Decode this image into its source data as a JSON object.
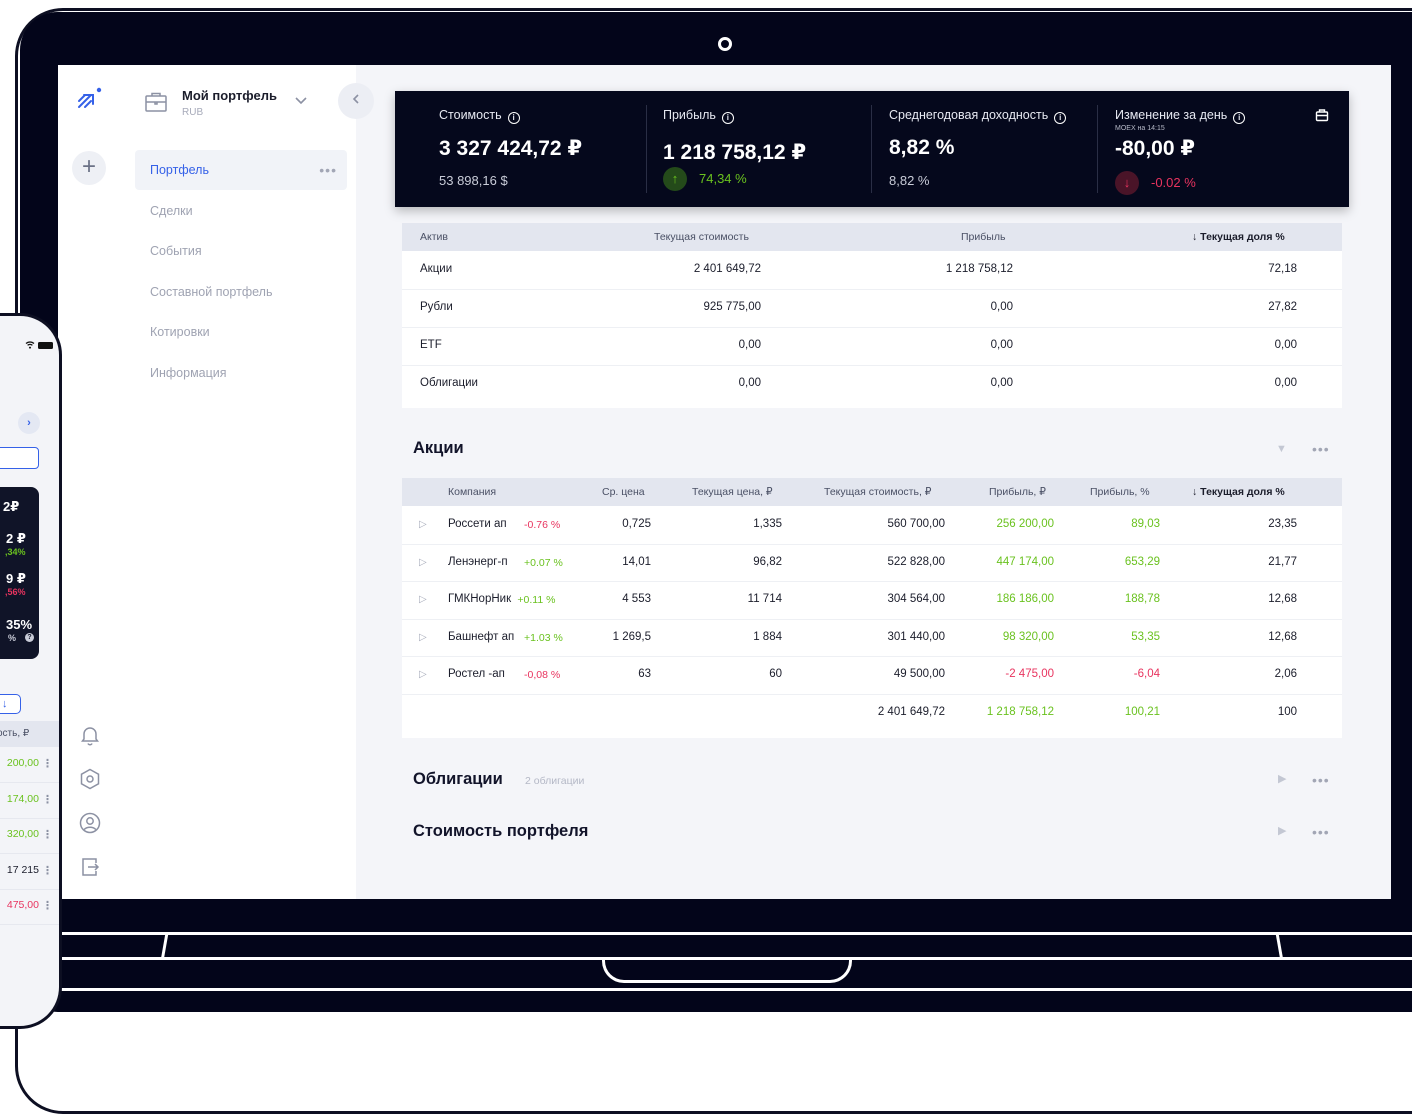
{
  "app": {
    "portfolio_name": "Мой портфель",
    "portfolio_currency": "RUB",
    "menu": [
      {
        "label": "Портфель",
        "active": true
      },
      {
        "label": "Сделки"
      },
      {
        "label": "События"
      },
      {
        "label": "Составной портфель"
      },
      {
        "label": "Котировки"
      },
      {
        "label": "Информация"
      }
    ],
    "rail_icons": [
      "bell-icon",
      "settings-hex-icon",
      "user-icon",
      "logout-icon"
    ]
  },
  "stats": [
    {
      "label": "Стоимость",
      "value": "3 327 424,72 ₽",
      "sub": "53 898,16 $"
    },
    {
      "label": "Прибыль",
      "value": "1 218 758,12 ₽",
      "sub": "74,34 %",
      "trend": "up"
    },
    {
      "label": "Среднегодовая доходность",
      "value": "8,82 %",
      "sub": "8,82 %"
    },
    {
      "label": "Изменение за день",
      "note": "MOEX на 14:15",
      "value": "-80,00 ₽",
      "sub": "-0.02 %",
      "trend": "down"
    }
  ],
  "summary": {
    "headers": [
      "Актив",
      "Текущая стоимость",
      "Прибыль",
      "Текущая доля %"
    ],
    "rows": [
      [
        "Акции",
        "2 401 649,72",
        "1 218 758,12",
        "72,18"
      ],
      [
        "Рубли",
        "925 775,00",
        "0,00",
        "27,82"
      ],
      [
        "ETF",
        "0,00",
        "0,00",
        "0,00"
      ],
      [
        "Облигации",
        "0,00",
        "0,00",
        "0,00"
      ]
    ]
  },
  "stocks": {
    "title": "Акции",
    "headers": [
      "Компания",
      "Ср. цена",
      "Текущая цена, ₽",
      "Текущая стоимость, ₽",
      "Прибыль, ₽",
      "Прибыль, %",
      "Текущая доля %"
    ],
    "rows": [
      {
        "name": "Россети ап",
        "change": "-0.76 %",
        "avg": "0,725",
        "price": "1,335",
        "value": "560 700,00",
        "profit": "256 200,00",
        "profit_pct": "89,03",
        "share": "23,35"
      },
      {
        "name": "Ленэнерг-п",
        "change": "+0.07 %",
        "avg": "14,01",
        "price": "96,82",
        "value": "522 828,00",
        "profit": "447 174,00",
        "profit_pct": "653,29",
        "share": "21,77"
      },
      {
        "name": "ГМКНорНик",
        "change": "+0.11 %",
        "avg": "4 553",
        "price": "11 714",
        "value": "304 564,00",
        "profit": "186 186,00",
        "profit_pct": "188,78",
        "share": "12,68"
      },
      {
        "name": "Башнефт ап",
        "change": "+1.03 %",
        "avg": "1 269,5",
        "price": "1 884",
        "value": "301 440,00",
        "profit": "98 320,00",
        "profit_pct": "53,35",
        "share": "12,68"
      },
      {
        "name": "Ростел -ап",
        "change": "-0,08 %",
        "avg": "63",
        "price": "60",
        "value": "49 500,00",
        "profit": "-2 475,00",
        "profit_pct": "-6,04",
        "share": "2,06"
      }
    ],
    "totals": {
      "value": "2 401 649,72",
      "profit": "1 218 758,12",
      "profit_pct": "100,21",
      "share": "100"
    }
  },
  "bonds": {
    "title": "Облигации",
    "subtitle": "2 облигации"
  },
  "portfolio_value": {
    "title": "Стоимость портфеля"
  },
  "phone": {
    "fragments": [
      "2₽",
      "2 ₽",
      ",34%",
      "9 ₽",
      ",56%",
      "35%",
      "%",
      "ость, ₽"
    ],
    "values": [
      "200,00",
      "174,00",
      "320,00",
      "17 215",
      "475,00"
    ]
  }
}
